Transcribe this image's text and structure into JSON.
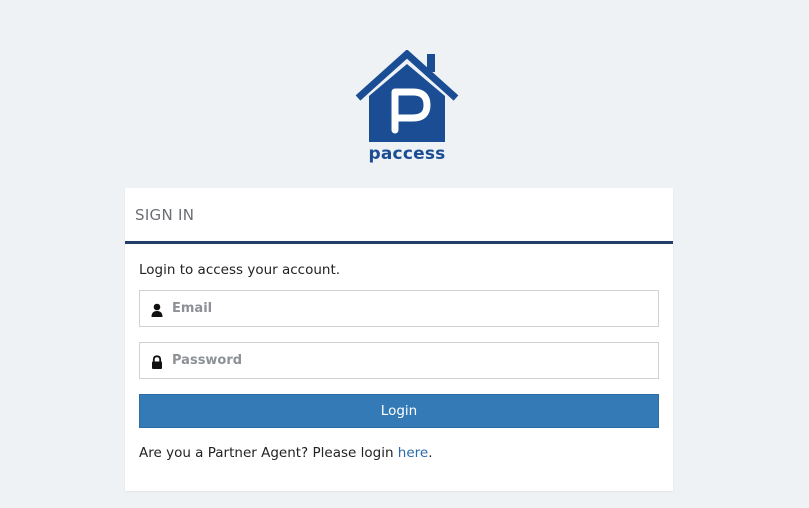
{
  "brand": {
    "name": "paccess",
    "color": "#1a4d94"
  },
  "signin": {
    "title": "SIGN IN",
    "intro": "Login to access your account.",
    "email_placeholder": "Email",
    "password_placeholder": "Password",
    "login_label": "Login",
    "partner_prefix": "Are you a Partner Agent? Please login ",
    "partner_link": "here",
    "partner_suffix": ".",
    "button_color": "#337ab7",
    "header_rule_color": "#1f3f66"
  },
  "icons": {
    "logo": "house-p-logo-icon",
    "email": "user-icon",
    "password": "lock-icon"
  }
}
